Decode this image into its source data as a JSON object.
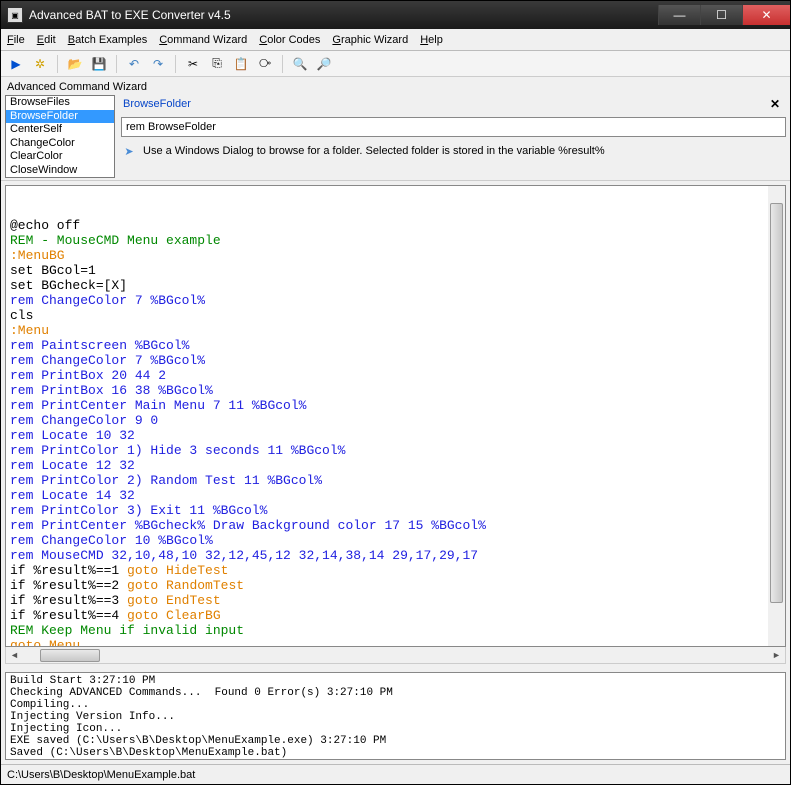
{
  "title": "Advanced BAT to EXE Converter v4.5",
  "menu": [
    "File",
    "Edit",
    "Batch Examples",
    "Command Wizard",
    "Color Codes",
    "Graphic Wizard",
    "Help"
  ],
  "toolbar_icons": [
    "play",
    "gear",
    "open",
    "save",
    "undo",
    "redo",
    "cut",
    "copy",
    "paste",
    "find",
    "zoom-in",
    "zoom-out"
  ],
  "wizard": {
    "section_label": "Advanced Command Wizard",
    "commands": [
      "BrowseFiles",
      "BrowseFolder",
      "CenterSelf",
      "ChangeColor",
      "ClearColor",
      "CloseWindow"
    ],
    "selected_index": 1,
    "title": "BrowseFolder",
    "input_value": "rem BrowseFolder",
    "description": "Use a Windows Dialog to browse for a folder. Selected folder is stored in the variable %result%"
  },
  "editor_lines": [
    {
      "t": "@echo off",
      "c": "black"
    },
    {
      "t": "REM - MouseCMD Menu example",
      "c": "green"
    },
    {
      "t": ":MenuBG",
      "c": "orange"
    },
    {
      "t": "set BGcol=1",
      "c": "black"
    },
    {
      "t": "set BGcheck=[X]",
      "c": "black"
    },
    {
      "t": "rem ChangeColor 7 %BGcol%",
      "c": "blue"
    },
    {
      "t": "cls",
      "c": "black"
    },
    {
      "t": ":Menu",
      "c": "orange"
    },
    {
      "t": "rem Paintscreen %BGcol%",
      "c": "blue"
    },
    {
      "t": "rem ChangeColor 7 %BGcol%",
      "c": "blue"
    },
    {
      "t": "rem PrintBox 20 44 2",
      "c": "blue"
    },
    {
      "t": "rem PrintBox 16 38 %BGcol%",
      "c": "blue"
    },
    {
      "t": "rem PrintCenter Main Menu 7 11 %BGcol%",
      "c": "blue"
    },
    {
      "t": "rem ChangeColor 9 0",
      "c": "blue"
    },
    {
      "t": "rem Locate 10 32",
      "c": "blue"
    },
    {
      "t": "rem PrintColor 1) Hide 3 seconds 11 %BGcol%",
      "c": "blue"
    },
    {
      "t": "rem Locate 12 32",
      "c": "blue"
    },
    {
      "t": "rem PrintColor 2) Random Test 11 %BGcol%",
      "c": "blue"
    },
    {
      "t": "rem Locate 14 32",
      "c": "blue"
    },
    {
      "t": "rem PrintColor 3) Exit 11 %BGcol%",
      "c": "blue"
    },
    {
      "t": "rem PrintCenter %BGcheck% Draw Background color 17 15 %BGcol%",
      "c": "blue"
    },
    {
      "t": "rem ChangeColor 10 %BGcol%",
      "c": "blue"
    },
    {
      "t": "rem MouseCMD 32,10,48,10 32,12,45,12 32,14,38,14 29,17,29,17",
      "c": "blue"
    },
    {
      "seg": [
        {
          "t": "if %result%==1 ",
          "c": "black"
        },
        {
          "t": "goto HideTest",
          "c": "orange"
        }
      ]
    },
    {
      "seg": [
        {
          "t": "if %result%==2 ",
          "c": "black"
        },
        {
          "t": "goto RandomTest",
          "c": "orange"
        }
      ]
    },
    {
      "seg": [
        {
          "t": "if %result%==3 ",
          "c": "black"
        },
        {
          "t": "goto EndTest",
          "c": "orange"
        }
      ]
    },
    {
      "seg": [
        {
          "t": "if %result%==4 ",
          "c": "black"
        },
        {
          "t": "goto ClearBG",
          "c": "orange"
        }
      ]
    },
    {
      "t": "REM Keep Menu if invalid input",
      "c": "green"
    },
    {
      "t": "goto Menu",
      "c": "orange"
    }
  ],
  "output_lines": [
    "Build Start 3:27:10 PM",
    "Checking ADVANCED Commands...  Found 0 Error(s) 3:27:10 PM",
    "Compiling...",
    "Injecting Version Info...",
    "Injecting Icon...",
    "EXE saved (C:\\Users\\B\\Desktop\\MenuExample.exe) 3:27:10 PM",
    "Saved (C:\\Users\\B\\Desktop\\MenuExample.bat)"
  ],
  "status": "C:\\Users\\B\\Desktop\\MenuExample.bat"
}
